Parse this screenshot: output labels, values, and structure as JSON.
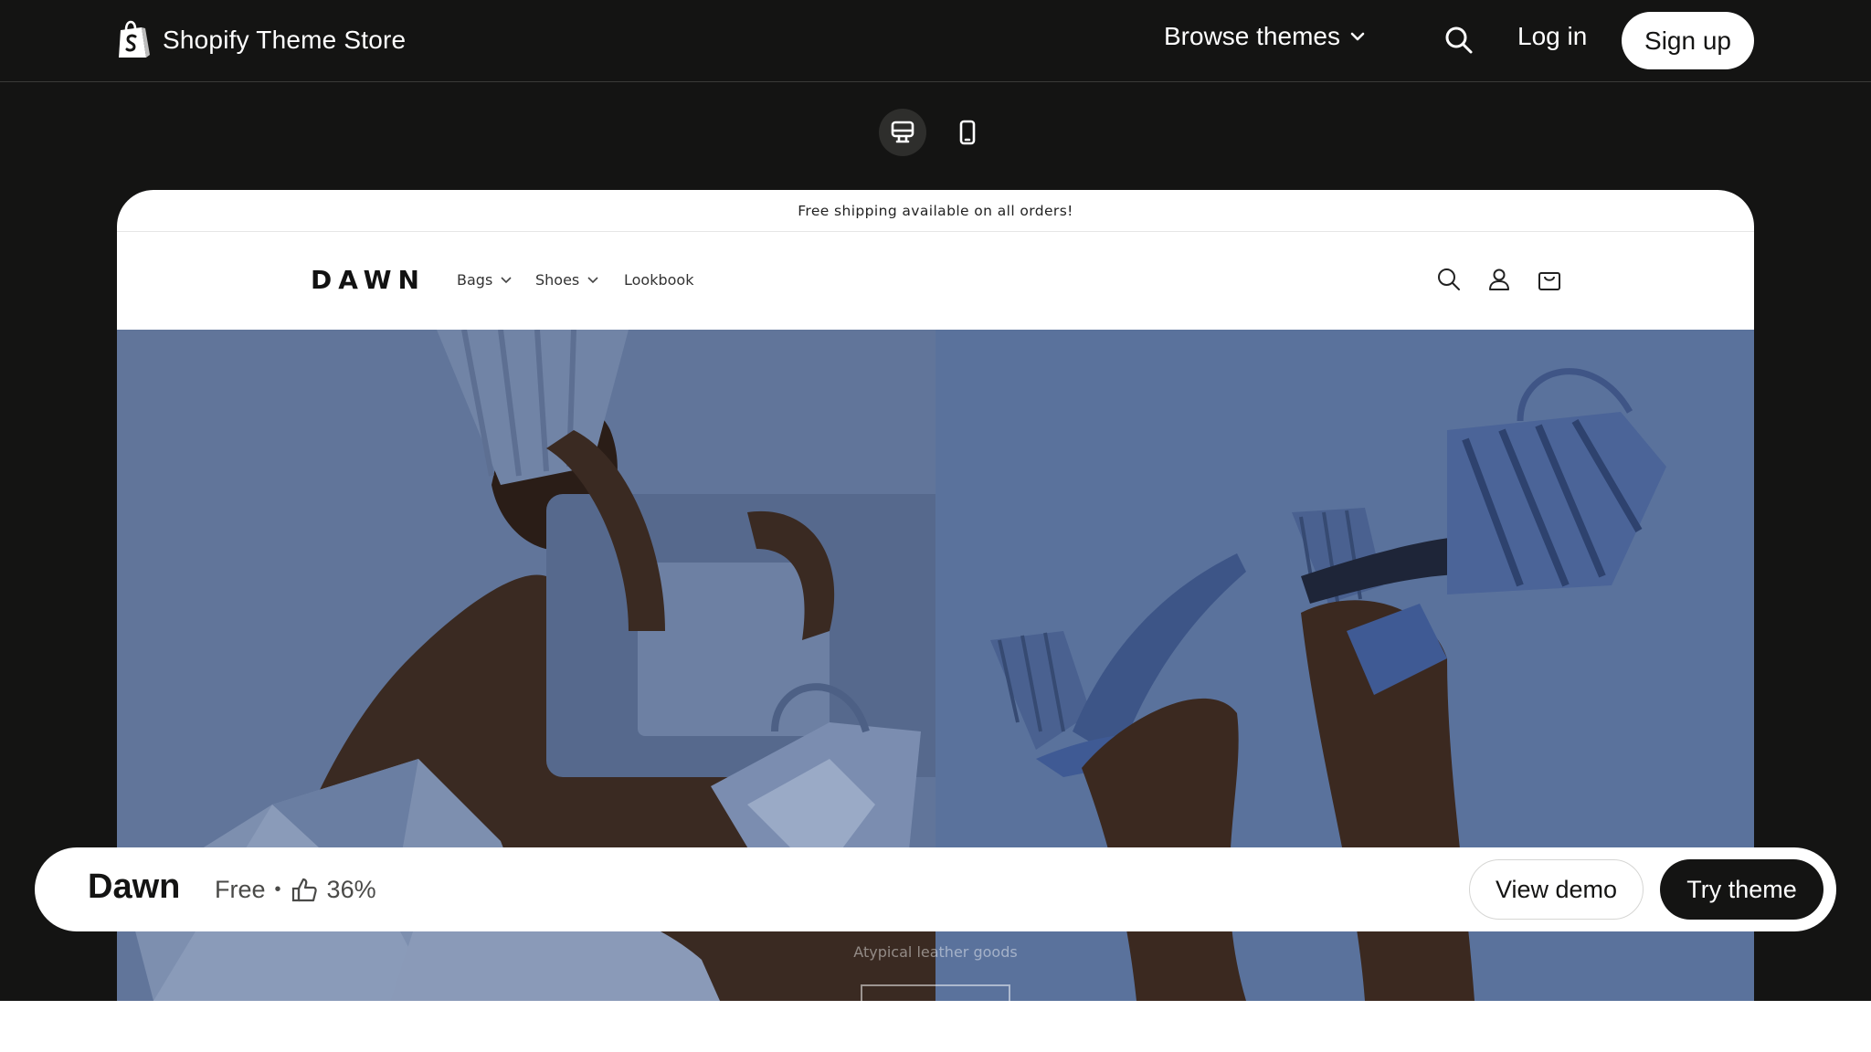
{
  "topnav": {
    "brand": "Shopify Theme Store",
    "browse_label": "Browse themes",
    "login_label": "Log in",
    "signup_label": "Sign up"
  },
  "preview": {
    "announcement": "Free shipping available on all orders!",
    "logo": "DAWN",
    "nav": [
      {
        "label": "Bags",
        "has_dropdown": true
      },
      {
        "label": "Shoes",
        "has_dropdown": true
      },
      {
        "label": "Lookbook",
        "has_dropdown": false
      }
    ],
    "hero_subtitle": "Atypical leather goods"
  },
  "theme_bar": {
    "name": "Dawn",
    "price": "Free",
    "rating": "36%",
    "view_demo_label": "View demo",
    "try_theme_label": "Try theme"
  }
}
